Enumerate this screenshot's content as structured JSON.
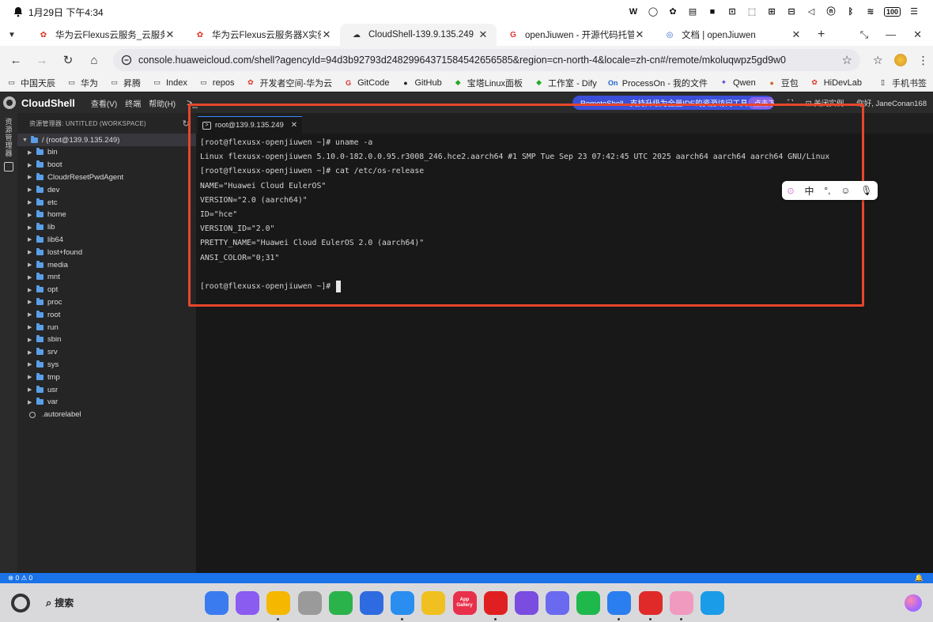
{
  "status_bar": {
    "datetime": "1月29日 下午4:34",
    "battery": "100"
  },
  "browser": {
    "tabs": [
      {
        "title": "华为云Flexus云服务_云服务器_F",
        "favicon": "huawei-icon",
        "active": false
      },
      {
        "title": "华为云Flexus云服务器X实例 -",
        "favicon": "huawei-icon",
        "active": false
      },
      {
        "title": "CloudShell-139.9.135.249",
        "favicon": "cloudshell-icon",
        "active": true
      },
      {
        "title": "openJiuwen - 开源代码托管,代",
        "favicon": "google-icon",
        "active": false
      },
      {
        "title": "文档 | openJiuwen",
        "favicon": "openjiuwen-icon",
        "active": false
      }
    ],
    "url": "console.huaweicloud.com/shell?agencyId=94d3b92793d2482996437158454265658region=cn-north-4&locale=zh-cn#/remote/mkoluqwpz5gd9w0",
    "url_display": "console.huaweicloud.com/shell?agencyId=94d3b92793d24829964371584542656585&region=cn-north-4&locale=zh-cn#/remote/mkoluqwpz5gd9w0",
    "bookmarks": [
      {
        "label": "中国天辰",
        "icon": "folder-icon"
      },
      {
        "label": "华为",
        "icon": "folder-icon"
      },
      {
        "label": "昇腾",
        "icon": "folder-icon"
      },
      {
        "label": "Index",
        "icon": "folder-icon"
      },
      {
        "label": "repos",
        "icon": "folder-icon"
      },
      {
        "label": "开发者空间-华为云",
        "icon": "huawei-icon"
      },
      {
        "label": "GitCode",
        "icon": "gitcode-icon"
      },
      {
        "label": "GitHub",
        "icon": "github-icon"
      },
      {
        "label": "宝塔Linux面板",
        "icon": "baota-icon"
      },
      {
        "label": "工作室 - Dify",
        "icon": "dify-icon"
      },
      {
        "label": "ProcessOn - 我的文件",
        "icon": "processon-icon"
      },
      {
        "label": "Qwen",
        "icon": "qwen-icon"
      },
      {
        "label": "豆包",
        "icon": "doubao-icon"
      },
      {
        "label": "HiDevLab",
        "icon": "huawei-icon"
      }
    ],
    "mobile_bookmarks": "手机书签"
  },
  "cloudshell": {
    "product_name": "CloudShell",
    "menu": [
      "查看(V)",
      "终端",
      "帮助(H)"
    ],
    "terminal_glyph": ">_",
    "remote_banner": "RemoteShell - 支持升级为全量IDE的资源访问工具",
    "remote_banner_button": "点击下载",
    "close_instance": "关闭实例",
    "greeting": "你好, JaneConan168",
    "sidebar_label": "资源管理器",
    "explorer_title": "资源管理器: UNTITLED (WORKSPACE)",
    "root_label": "/ (root@139.9.135.249)",
    "folders": [
      "bin",
      "boot",
      "CloudrResetPwdAgent",
      "dev",
      "etc",
      "home",
      "lib",
      "lib64",
      "lost+found",
      "media",
      "mnt",
      "opt",
      "proc",
      "root",
      "run",
      "sbin",
      "srv",
      "sys",
      "tmp",
      "usr",
      "var"
    ],
    "files": [
      ".autorelabel"
    ],
    "terminal_tab": "root@139.9.135.249",
    "terminal_lines": [
      "[root@flexusx-openjiuwen ~]# uname -a",
      "Linux flexusx-openjiuwen 5.10.0-182.0.0.95.r3008_246.hce2.aarch64 #1 SMP Tue Sep 23 07:42:45 UTC 2025 aarch64 aarch64 aarch64 GNU/Linux",
      "[root@flexusx-openjiuwen ~]# cat /etc/os-release",
      "NAME=\"Huawei Cloud EulerOS\"",
      "VERSION=\"2.0 (aarch64)\"",
      "ID=\"hce\"",
      "VERSION_ID=\"2.0\"",
      "PRETTY_NAME=\"Huawei Cloud EulerOS 2.0 (aarch64)\"",
      "ANSI_COLOR=\"0;31\"",
      "",
      "[root@flexusx-openjiuwen ~]# "
    ],
    "status_left": "⊗ 0 ⚠ 0"
  },
  "ime": {
    "mode": "中",
    "punct": "°,"
  },
  "taskbar": {
    "search_label": "搜索",
    "apps": [
      {
        "name": "app-launcher-icon",
        "color": "#3a7bf0"
      },
      {
        "name": "multitask-icon",
        "color": "#8a5cf0"
      },
      {
        "name": "files-icon",
        "color": "#f5b700"
      },
      {
        "name": "trash-icon",
        "color": "#9a9a9a"
      },
      {
        "name": "wechat-icon",
        "color": "#2ab34a"
      },
      {
        "name": "search-app-icon",
        "color": "#2f6be0"
      },
      {
        "name": "browser-icon",
        "color": "#2a8ef0"
      },
      {
        "name": "notes-icon",
        "color": "#f0c020"
      },
      {
        "name": "app-gallery-icon",
        "color": "#e8304a",
        "label": "App Gallery"
      },
      {
        "name": "gitcode-app-icon",
        "color": "#e02020"
      },
      {
        "name": "devtool-icon",
        "color": "#7a4ce0"
      },
      {
        "name": "cleaner-icon",
        "color": "#6a6af0"
      },
      {
        "name": "phone-icon",
        "color": "#1fb84a"
      },
      {
        "name": "messages-icon",
        "color": "#2a7ef0"
      },
      {
        "name": "wps-icon",
        "color": "#e02a2a"
      },
      {
        "name": "photos-icon",
        "color": "#f09ac0"
      },
      {
        "name": "edge-icon",
        "color": "#1a9ce8"
      }
    ]
  },
  "colors": {
    "accent_blue": "#1a73e8",
    "annotation_red": "#e8462b",
    "terminal_bg": "#181818",
    "explorer_bg": "#252526",
    "folder_blue": "#5aa0e8"
  }
}
